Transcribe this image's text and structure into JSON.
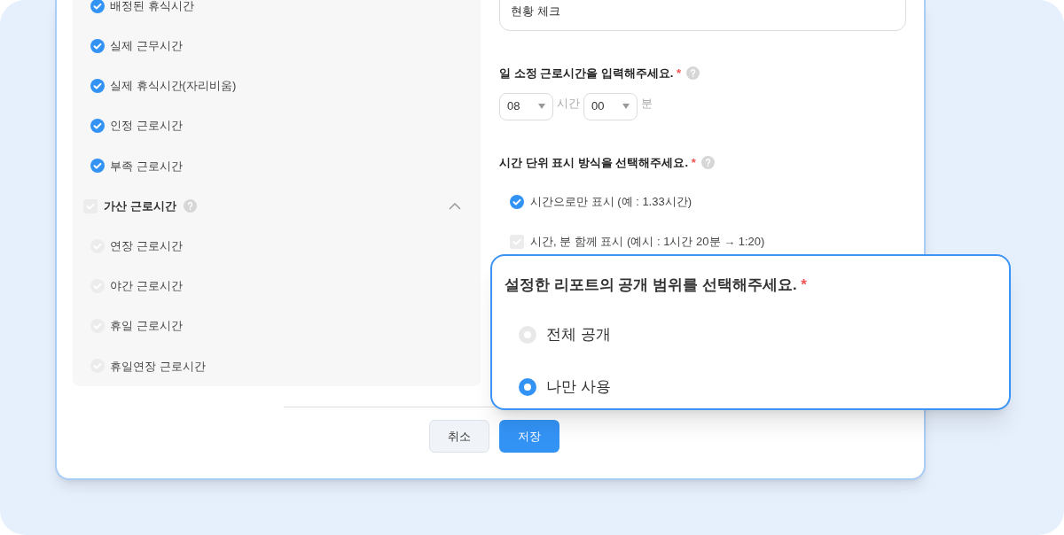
{
  "basic_items": [
    {
      "label": "배정된 휴식시간",
      "checked": true
    },
    {
      "label": "실제 근무시간",
      "checked": true
    },
    {
      "label": "실제 휴식시간(자리비움)",
      "checked": true
    },
    {
      "label": "인정 근로시간",
      "checked": true
    },
    {
      "label": "부족 근로시간",
      "checked": true
    }
  ],
  "extra_group": {
    "label": "가산 근로시간",
    "checked": false,
    "expanded": true,
    "children": [
      {
        "label": "연장 근로시간",
        "checked": false
      },
      {
        "label": "야간 근로시간",
        "checked": false
      },
      {
        "label": "휴일 근로시간",
        "checked": false
      },
      {
        "label": "휴일연장 근로시간",
        "checked": false
      }
    ]
  },
  "report_name": {
    "value": "현황 체크"
  },
  "work_hours": {
    "label": "일 소정 근로시간을 입력해주세요.",
    "required": "*",
    "hours": "08",
    "hours_unit": "시간",
    "minutes": "00",
    "minutes_unit": "분"
  },
  "time_format": {
    "label": "시간 단위 표시 방식을 선택해주세요.",
    "required": "*",
    "options": [
      {
        "label": "시간으로만 표시 (예 : 1.33시간)",
        "checked": true
      },
      {
        "label": "시간, 분 함께 표시 (예시 : 1시간 20분 → 1:20)",
        "checked": false
      }
    ]
  },
  "visibility_popup": {
    "label": "설정한 리포트의 공개 범위를 선택해주세요.",
    "required": "*",
    "options": [
      {
        "label": "전체 공개",
        "selected": false
      },
      {
        "label": "나만 사용",
        "selected": true
      }
    ]
  },
  "buttons": [
    {
      "label": "취소",
      "kind": "secondary"
    },
    {
      "label": "저장",
      "kind": "primary"
    }
  ]
}
